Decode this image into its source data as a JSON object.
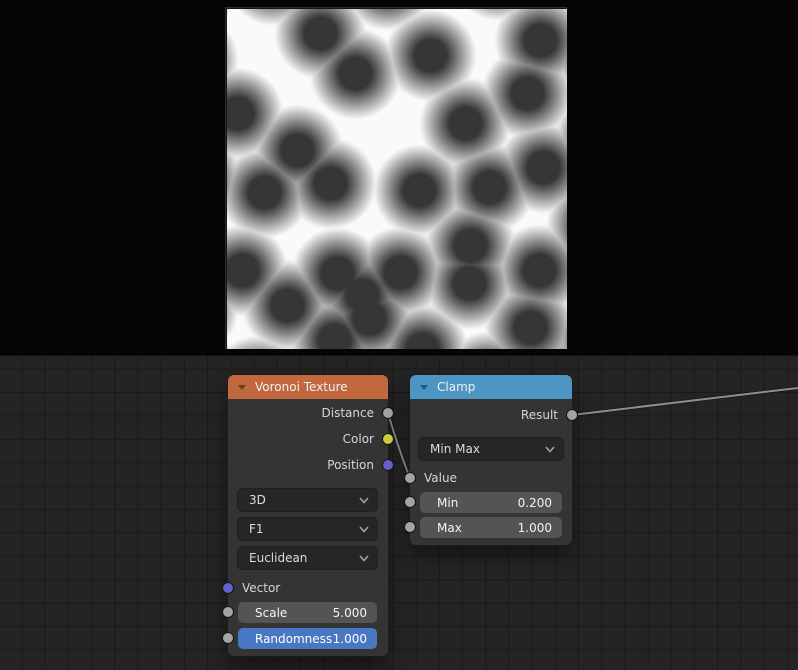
{
  "voronoi_node": {
    "title": "Voronoi Texture",
    "outputs": [
      {
        "label": "Distance"
      },
      {
        "label": "Color"
      },
      {
        "label": "Position"
      }
    ],
    "dimensions_dropdown": "3D",
    "feature_dropdown": "F1",
    "distance_metric_dropdown": "Euclidean",
    "vector_input_label": "Vector",
    "scale_field": {
      "label": "Scale",
      "value": "5.000"
    },
    "randomness_field": {
      "label": "Randomness",
      "value": "1.000"
    }
  },
  "clamp_node": {
    "title": "Clamp",
    "output_label": "Result",
    "clamp_type_dropdown": "Min Max",
    "value_input_label": "Value",
    "min_field": {
      "label": "Min",
      "value": "0.200"
    },
    "max_field": {
      "label": "Max",
      "value": "1.000"
    }
  },
  "colors": {
    "voronoi_header": "#c1683e",
    "clamp_header": "#4d96c4",
    "active_field_blue": "#4a77c4",
    "socket_gray": "#a3a3a3",
    "socket_yellow": "#cdcd3a",
    "socket_purple": "#6360c9",
    "wire_gray": "#8d8d8d",
    "editor_background": "#242424",
    "grid_line": "#1a1a1a"
  },
  "preview": {
    "size": 340,
    "flat_gray": 54,
    "ramp_start": 16,
    "ramp_length": 30,
    "ramp_range": 196,
    "points": [
      [
        93,
        24
      ],
      [
        203,
        46
      ],
      [
        313,
        31
      ],
      [
        128,
        64
      ],
      [
        300,
        84
      ],
      [
        10,
        104
      ],
      [
        238,
        114
      ],
      [
        70,
        141
      ],
      [
        192,
        181
      ],
      [
        103,
        174
      ],
      [
        37,
        183
      ],
      [
        262,
        178
      ],
      [
        316,
        158
      ],
      [
        243,
        236
      ],
      [
        15,
        261
      ],
      [
        110,
        264
      ],
      [
        173,
        263
      ],
      [
        242,
        274
      ],
      [
        312,
        261
      ],
      [
        60,
        296
      ],
      [
        135,
        286
      ],
      [
        142,
        309
      ],
      [
        303,
        318
      ],
      [
        107,
        331
      ],
      [
        195,
        340
      ],
      [
        -35,
        50
      ],
      [
        -30,
        170
      ],
      [
        -35,
        300
      ],
      [
        45,
        -30
      ],
      [
        160,
        -25
      ],
      [
        270,
        -35
      ],
      [
        368,
        40
      ],
      [
        372,
        130
      ],
      [
        365,
        215
      ],
      [
        370,
        330
      ],
      [
        30,
        372
      ],
      [
        150,
        370
      ],
      [
        260,
        368
      ],
      [
        340,
        372
      ],
      [
        -30,
        -30
      ],
      [
        370,
        -25
      ],
      [
        -30,
        368
      ],
      [
        375,
        375
      ]
    ]
  }
}
